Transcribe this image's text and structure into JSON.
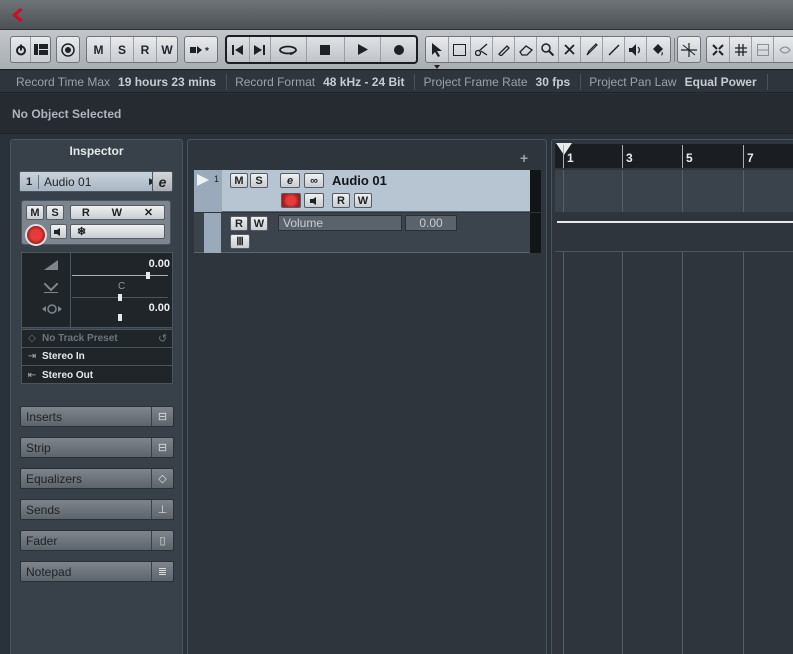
{
  "toolbar": {
    "buttons_msrw": [
      "M",
      "S",
      "R",
      "W"
    ],
    "info": [
      {
        "label": "Record Time Max",
        "value": "19 hours 23 mins"
      },
      {
        "label": "Record Format",
        "value": "48 kHz - 24 Bit"
      },
      {
        "label": "Project Frame Rate",
        "value": "30 fps"
      },
      {
        "label": "Project Pan Law",
        "value": "Equal Power"
      }
    ]
  },
  "status": {
    "text": "No Object Selected"
  },
  "inspector": {
    "title": "Inspector",
    "track_number": "1",
    "track_name": "Audio 01",
    "buttons": [
      "M",
      "S",
      "R",
      "W"
    ],
    "volume_value": "0.00",
    "pan_label": "C",
    "delay_value": "0.00",
    "preset": "No Track Preset",
    "input": "Stereo In",
    "output": "Stereo Out",
    "sections": [
      "Inserts",
      "Strip",
      "Equalizers",
      "Sends",
      "Fader",
      "Notepad"
    ]
  },
  "tracklist": {
    "track": {
      "number": "1",
      "name": "Audio 01",
      "buttons": [
        "M",
        "S",
        "R",
        "W"
      ],
      "automation": {
        "param": "Volume",
        "value": "0.00",
        "buttons": [
          "R",
          "W"
        ]
      }
    }
  },
  "ruler": {
    "bars": [
      "1",
      "3",
      "5",
      "7"
    ]
  },
  "colors": {
    "record": "#e83a3a",
    "accent": "#b7c4d1"
  }
}
